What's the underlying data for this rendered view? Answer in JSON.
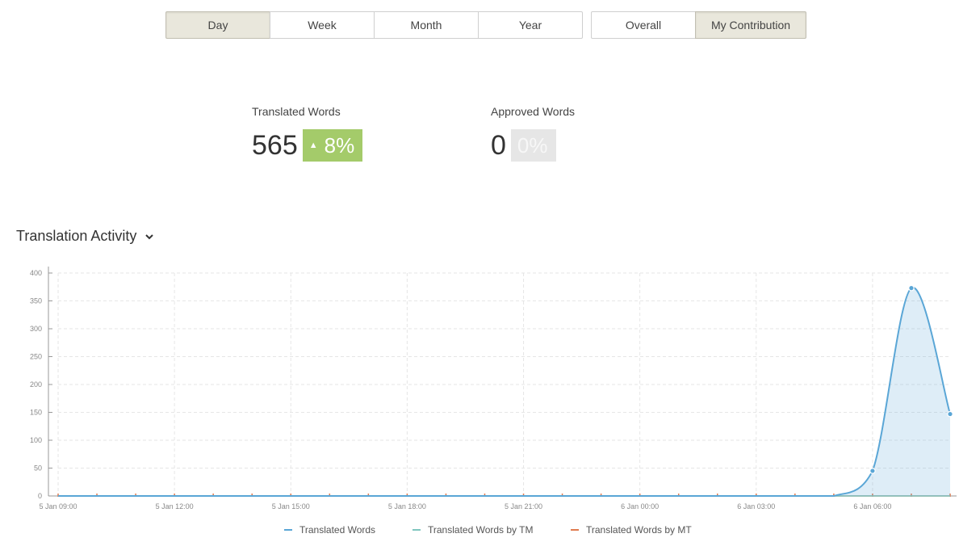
{
  "period_buttons": [
    {
      "label": "Day",
      "active": true
    },
    {
      "label": "Week",
      "active": false
    },
    {
      "label": "Month",
      "active": false
    },
    {
      "label": "Year",
      "active": false
    }
  ],
  "scope_buttons": [
    {
      "label": "Overall",
      "active": false
    },
    {
      "label": "My Contribution",
      "active": true
    }
  ],
  "stats": {
    "translated": {
      "label": "Translated Words",
      "value": "565",
      "change": "8%"
    },
    "approved": {
      "label": "Approved Words",
      "value": "0",
      "change": "0%"
    }
  },
  "section_title": "Translation Activity",
  "colors": {
    "accent_up": "#a4cb6a",
    "neutral_badge": "#e6e6e6",
    "series_translated": "#5aa6d6",
    "series_tm": "#7fc6bf",
    "series_mt": "#e07b4f"
  },
  "chart_data": {
    "type": "area",
    "ylim": [
      0,
      400
    ],
    "yticks": [
      0,
      50,
      100,
      150,
      200,
      250,
      300,
      350,
      400
    ],
    "x_hours": [
      0,
      1,
      2,
      3,
      4,
      5,
      6,
      7,
      8,
      9,
      10,
      11,
      12,
      13,
      14,
      15,
      16,
      17,
      18,
      19,
      20,
      21,
      22,
      23
    ],
    "xtick_labels": [
      {
        "hour": 0,
        "label": "5 Jan 09:00"
      },
      {
        "hour": 3,
        "label": "5 Jan 12:00"
      },
      {
        "hour": 6,
        "label": "5 Jan 15:00"
      },
      {
        "hour": 9,
        "label": "5 Jan 18:00"
      },
      {
        "hour": 12,
        "label": "5 Jan 21:00"
      },
      {
        "hour": 15,
        "label": "6 Jan 00:00"
      },
      {
        "hour": 18,
        "label": "6 Jan 03:00"
      },
      {
        "hour": 21,
        "label": "6 Jan 06:00"
      }
    ],
    "grid": true,
    "legend_position": "bottom",
    "series": [
      {
        "name": "Translated Words",
        "values": [
          0,
          0,
          0,
          0,
          0,
          0,
          0,
          0,
          0,
          0,
          0,
          0,
          0,
          0,
          0,
          0,
          0,
          0,
          0,
          0,
          0,
          45,
          373,
          147
        ]
      },
      {
        "name": "Translated Words by TM",
        "values": [
          0,
          0,
          0,
          0,
          0,
          0,
          0,
          0,
          0,
          0,
          0,
          0,
          0,
          0,
          0,
          0,
          0,
          0,
          0,
          0,
          0,
          0,
          0,
          0
        ]
      },
      {
        "name": "Translated Words by MT",
        "values": [
          0,
          0,
          0,
          0,
          0,
          0,
          0,
          0,
          0,
          0,
          0,
          0,
          0,
          0,
          0,
          0,
          0,
          0,
          0,
          0,
          0,
          0,
          0,
          0
        ]
      }
    ]
  }
}
